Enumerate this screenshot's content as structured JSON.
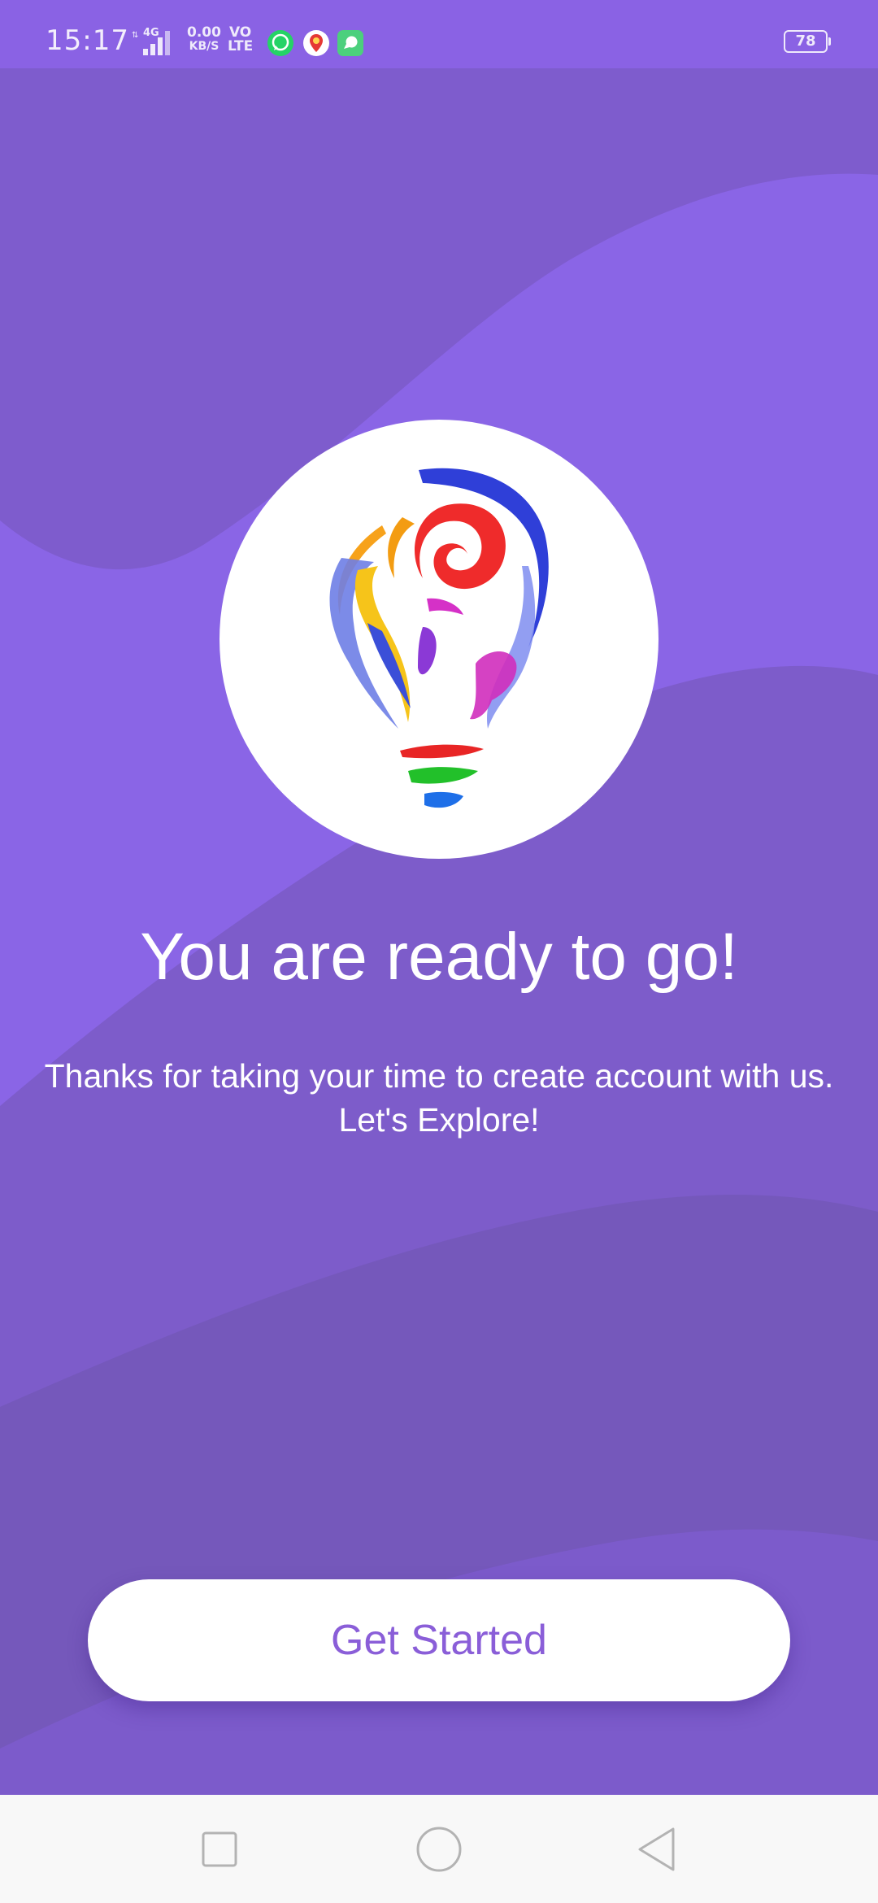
{
  "status_bar": {
    "time": "15:17",
    "network_type": "4G",
    "speed_value": "0.00",
    "speed_unit": "KB/S",
    "volte_line1": "VO",
    "volte_line2": "LTE",
    "battery_level": "78",
    "notification_icons": [
      "whatsapp-icon",
      "location-pin-icon",
      "chat-app-icon"
    ]
  },
  "welcome": {
    "headline": "You are ready to go!",
    "message": "Thanks for taking your time to create account with us. Let's Explore!"
  },
  "actions": {
    "get_started_label": "Get Started"
  },
  "nav_bar": {
    "buttons": [
      "recents-icon",
      "home-icon",
      "back-icon"
    ]
  },
  "colors": {
    "background": "#8a65e6",
    "wave_dark": "#7c5ac9",
    "wave_darker": "#7359bb",
    "button_text": "#8a5ed8",
    "nav_background": "#f8f8f8"
  }
}
